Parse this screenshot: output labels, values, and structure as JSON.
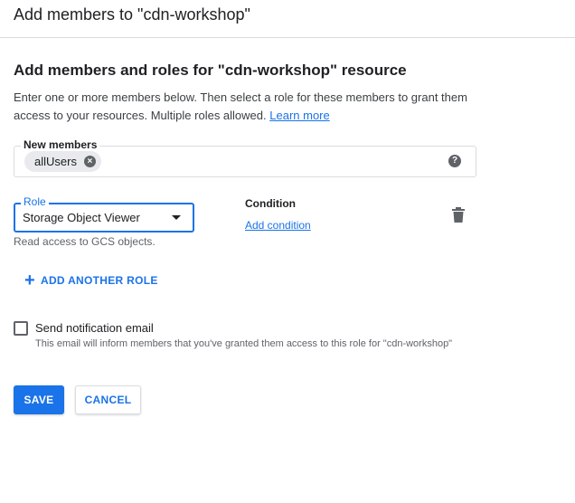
{
  "dialog": {
    "title": "Add members to \"cdn-workshop\""
  },
  "section": {
    "heading": "Add members and roles for \"cdn-workshop\" resource",
    "description": "Enter one or more members below. Then select a role for these members to grant them access to your resources. Multiple roles allowed.",
    "learn_more": "Learn more"
  },
  "members": {
    "label": "New members",
    "chips": [
      "allUsers"
    ],
    "chip_close_icon": "cancel-icon",
    "help_icon": "help-icon"
  },
  "role": {
    "label": "Role",
    "value": "Storage Object Viewer",
    "helper": "Read access to GCS objects."
  },
  "condition": {
    "label": "Condition",
    "add_link": "Add condition"
  },
  "add_another_role": "ADD ANOTHER ROLE",
  "notification": {
    "label": "Send notification email",
    "helper": "This email will inform members that you've granted them access to this role for \"cdn-workshop\"",
    "checked": false
  },
  "buttons": {
    "save": "SAVE",
    "cancel": "CANCEL"
  },
  "colors": {
    "accent": "#1a73e8",
    "text": "#202124",
    "secondary_text": "#5f6368",
    "divider": "#dadce0"
  }
}
